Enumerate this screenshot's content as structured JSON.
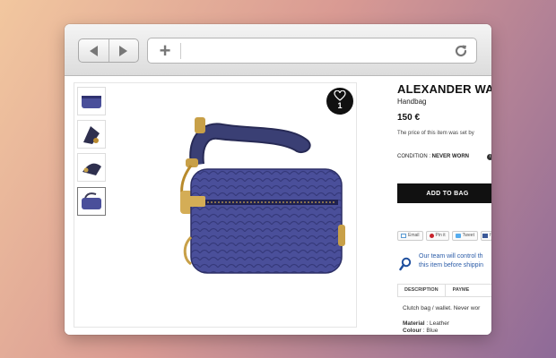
{
  "browser": {
    "back_icon": "back-arrow-icon",
    "forward_icon": "forward-arrow-icon",
    "new_tab_icon": "plus-icon",
    "reload_icon": "reload-icon",
    "address_value": ""
  },
  "gallery": {
    "thumbnails": [
      "thumbnail-1",
      "thumbnail-2",
      "thumbnail-3",
      "thumbnail-4"
    ],
    "active_thumbnail": 4,
    "favorite_count": "1",
    "bag_color": "#4a4f9a"
  },
  "product": {
    "title": "ALEXANDER WANG",
    "type": "Handbag",
    "price": "150 €",
    "price_note": "The price of this item was set by",
    "condition_label": "CONDITION : ",
    "condition_value": "NEVER WORN",
    "add_to_bag": "ADD TO BAG",
    "share": {
      "email": "Email",
      "pin": "Pin it",
      "tweet": "Tweet",
      "facebook": "f"
    },
    "team_line1": "Our team will control th",
    "team_line2": "this item before shippin",
    "tabs": [
      "DESCRIPTION",
      "PAYME"
    ],
    "description": "Clutch bag / wallet. Never wor",
    "material_label": "Material",
    "material_value": " : Leather",
    "colour_label": "Colour",
    "colour_value": " : Blue"
  }
}
